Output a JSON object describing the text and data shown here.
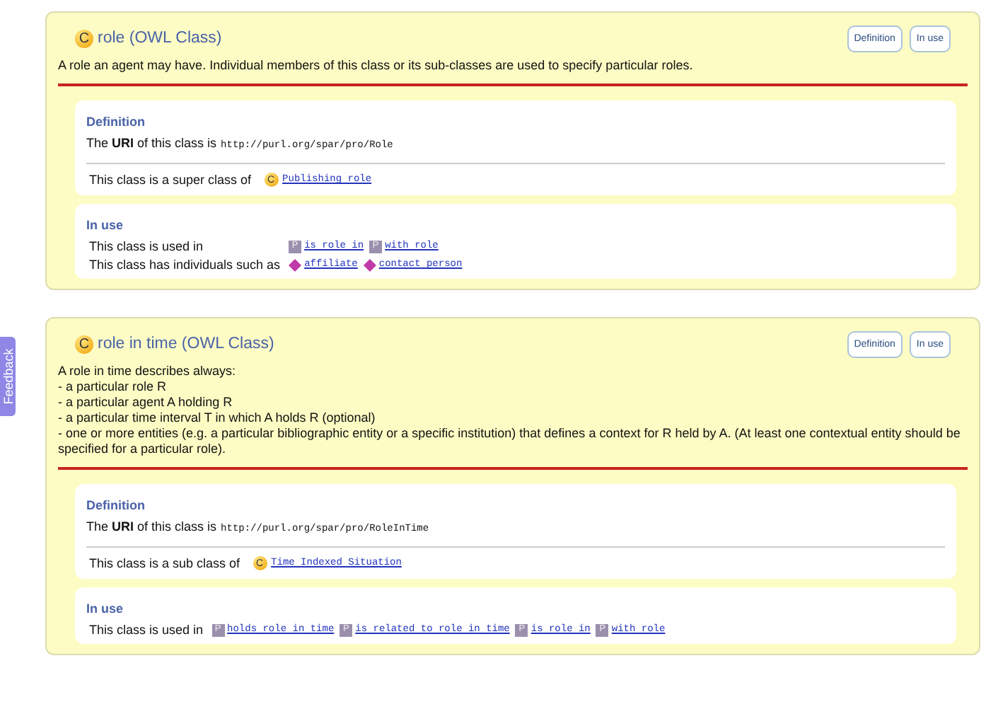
{
  "feedback_tab": "Feedback",
  "classes": [
    {
      "badge": "C",
      "title": "role (OWL Class)",
      "buttons": [
        "Definition",
        "In use"
      ],
      "description": [
        "A role an agent may have. Individual members of this class or its sub-classes are used to specify particular roles."
      ],
      "definition": {
        "heading": "Definition",
        "uri_label": "The **URI** of this class is",
        "uri": "http://purl.org/spar/pro/Role",
        "relation": {
          "label": "This class is a super class of",
          "links": [
            {
              "kind": "class",
              "badge": "C",
              "text": "Publishing role"
            }
          ]
        }
      },
      "in_use": {
        "heading": "In use",
        "rows": [
          {
            "label": "This class is used in",
            "links": [
              {
                "kind": "property",
                "badge": "P",
                "text": "is role in"
              },
              {
                "kind": "property",
                "badge": "P",
                "text": "with role"
              }
            ]
          },
          {
            "label": "This class has individuals such as",
            "links": [
              {
                "kind": "individual",
                "text": "affiliate"
              },
              {
                "kind": "individual",
                "text": "contact person"
              }
            ]
          }
        ]
      }
    },
    {
      "badge": "C",
      "title": "role in time (OWL Class)",
      "buttons": [
        "Definition",
        "In use"
      ],
      "description": [
        "A role in time describes always:",
        "- a particular role R",
        "- a particular agent A holding R",
        "- a particular time interval T in which A holds R (optional)",
        "- one or more entities (e.g. a particular bibliographic entity or a specific institution) that defines a context for R held by A. (At least one contextual entity should be specified for a particular role)."
      ],
      "definition": {
        "heading": "Definition",
        "uri_label": "The **URI** of this class is",
        "uri": "http://purl.org/spar/pro/RoleInTime",
        "relation": {
          "label": "This class is a sub class of",
          "links": [
            {
              "kind": "class",
              "badge": "C",
              "text": "Time Indexed Situation"
            }
          ]
        }
      },
      "in_use": {
        "heading": "In use",
        "rows": [
          {
            "label": "This class is used in",
            "links": [
              {
                "kind": "property",
                "badge": "P",
                "text": "holds role in time"
              },
              {
                "kind": "property",
                "badge": "P",
                "text": "is related to role in time"
              },
              {
                "kind": "property",
                "badge": "P",
                "text": "is role in"
              },
              {
                "kind": "property",
                "badge": "P",
                "text": "with role"
              }
            ]
          }
        ]
      }
    }
  ]
}
